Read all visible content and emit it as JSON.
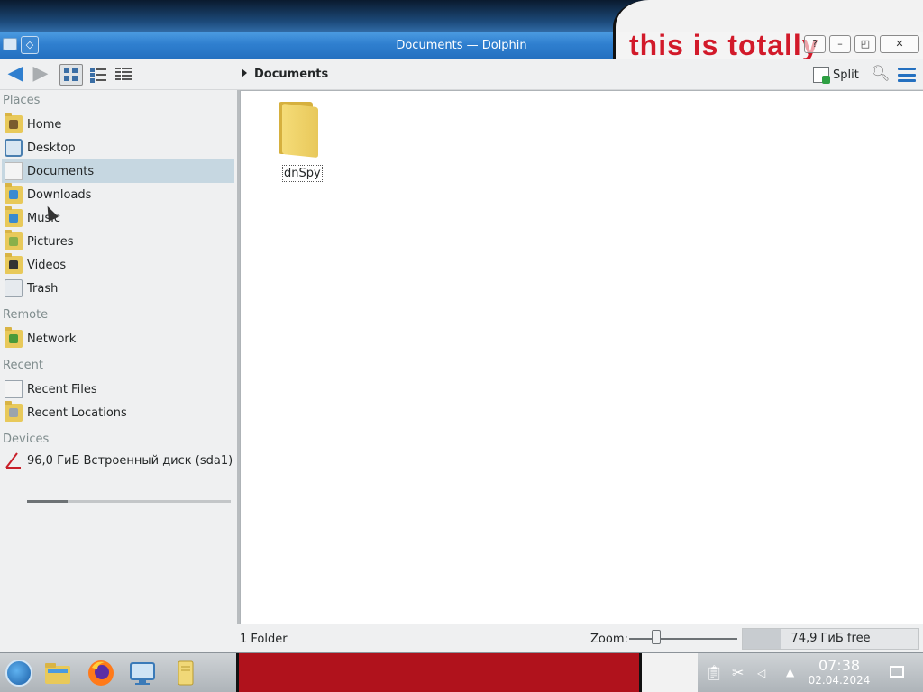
{
  "window": {
    "title": "Documents — Dolphin",
    "overlay_text": "this is totally",
    "buttons": [
      "?",
      "–",
      "◰",
      "✕"
    ]
  },
  "toolbar": {
    "back_icon": "arrow-left-icon",
    "forward_icon": "arrow-right-icon",
    "breadcrumb": "Documents",
    "split_label": "Split"
  },
  "sidebar": {
    "sections": {
      "places": "Places",
      "remote": "Remote",
      "recent": "Recent",
      "devices": "Devices"
    },
    "places": [
      {
        "label": "Home",
        "icon": "home-icon",
        "color": "#7a5c2e"
      },
      {
        "label": "Desktop",
        "icon": "desktop-icon",
        "color": "#4a7fb0"
      },
      {
        "label": "Documents",
        "icon": "documents-icon",
        "color": "#d8d8d8",
        "selected": true
      },
      {
        "label": "Downloads",
        "icon": "downloads-icon",
        "color": "#3a8ad0"
      },
      {
        "label": "Music",
        "icon": "music-icon",
        "color": "#3a8ad0"
      },
      {
        "label": "Pictures",
        "icon": "pictures-icon",
        "color": "#8ab04a"
      },
      {
        "label": "Videos",
        "icon": "videos-icon",
        "color": "#333333"
      },
      {
        "label": "Trash",
        "icon": "trash-icon",
        "color": "#9aa4ad"
      }
    ],
    "remote": [
      {
        "label": "Network",
        "icon": "network-icon",
        "color": "#4a9a3a"
      }
    ],
    "recent": [
      {
        "label": "Recent Files",
        "icon": "recent-files-icon",
        "color": "#8ab04a"
      },
      {
        "label": "Recent Locations",
        "icon": "recent-locations-icon",
        "color": "#e8c95a"
      }
    ],
    "devices": [
      {
        "label": "96,0 ГиБ Встроенный диск (sda1)",
        "icon": "drive-icon",
        "color": "#c8202a",
        "usage_fraction": 0.2
      }
    ]
  },
  "main": {
    "items": [
      {
        "name": "dnSpy",
        "icon": "folder-icon"
      }
    ]
  },
  "statusbar": {
    "count": "1 Folder",
    "zoom_label": "Zoom:",
    "zoom_level": 0.25,
    "free_space": "74,9 ГиБ free",
    "used_fraction": 0.22
  },
  "taskbar": {
    "apps": [
      "start-icon",
      "file-manager-icon",
      "firefox-icon",
      "system-settings-icon",
      "notes-icon"
    ],
    "clock_time": "07:38",
    "clock_date": "02.04.2024"
  }
}
